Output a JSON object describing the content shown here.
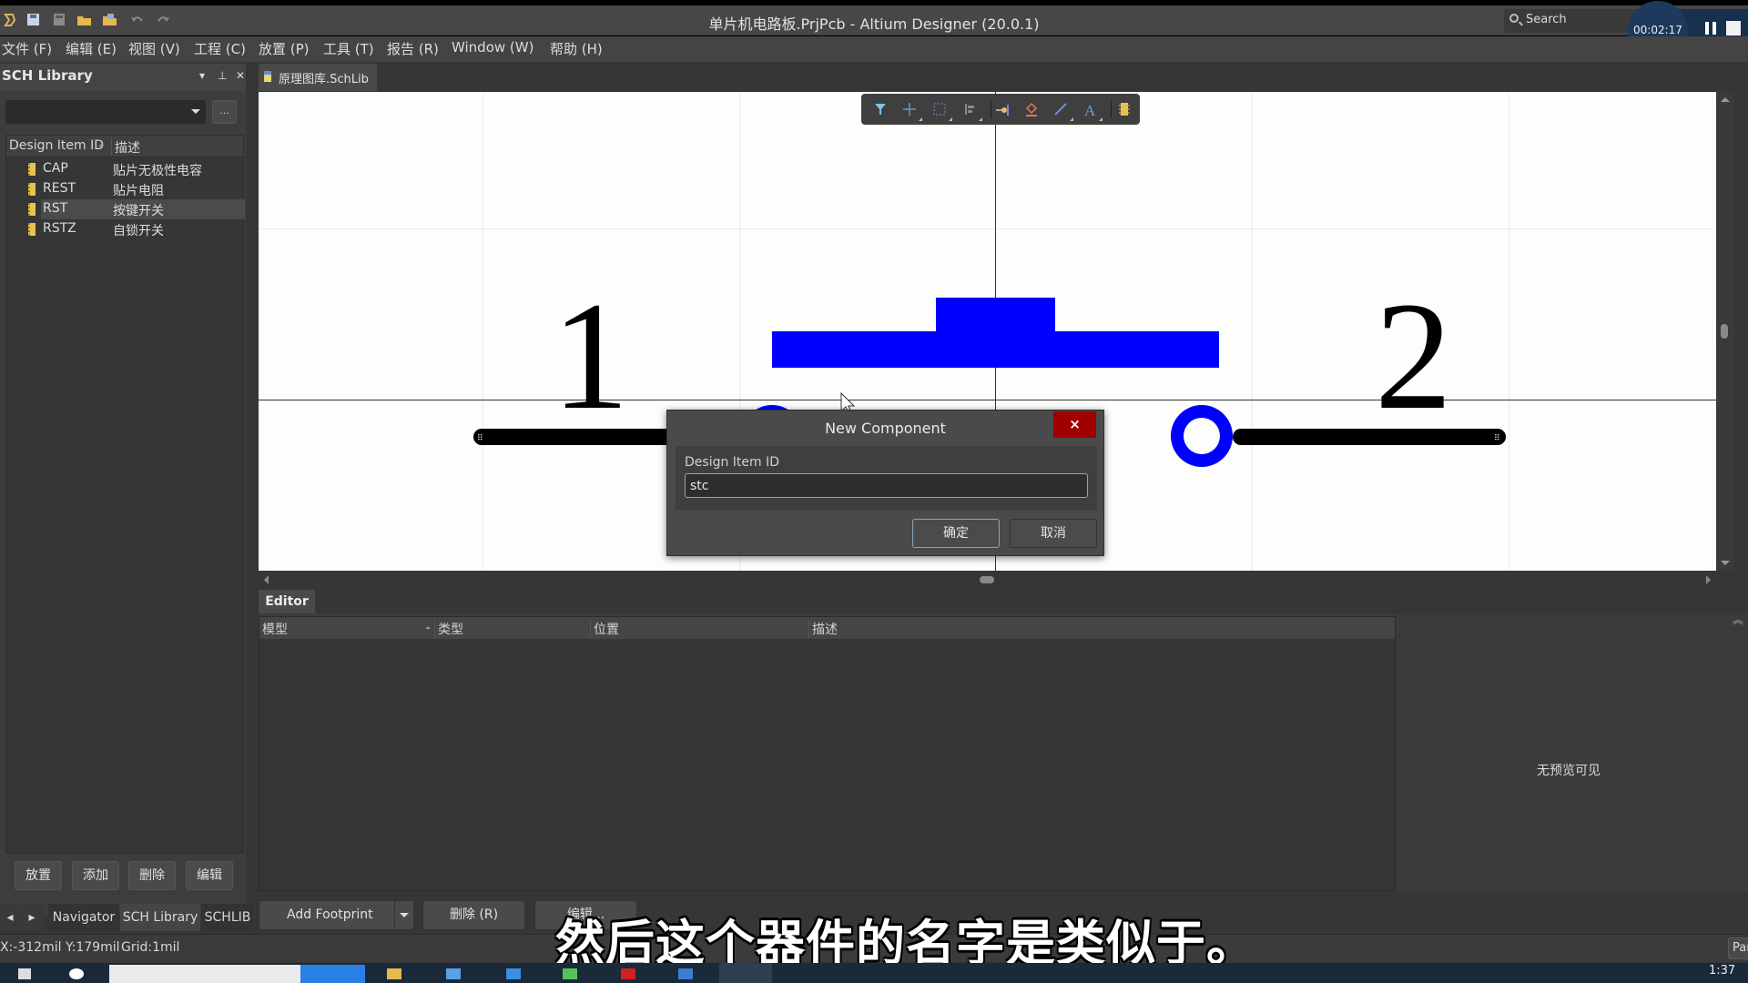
{
  "window": {
    "title": "单片机电路板.PrjPcb - Altium Designer (20.0.1)",
    "search_placeholder": "Search"
  },
  "recording": {
    "elapsed": "00:02:17"
  },
  "menu": [
    {
      "label": "文件 (F)"
    },
    {
      "label": "编辑 (E)"
    },
    {
      "label": "视图 (V)"
    },
    {
      "label": "工程 (C)"
    },
    {
      "label": "放置 (P)"
    },
    {
      "label": "工具 (T)"
    },
    {
      "label": "报告 (R)"
    },
    {
      "label": "Window (W)"
    },
    {
      "label": "帮助 (H)"
    }
  ],
  "sch_library": {
    "title": "SCH Library",
    "filter_value": "",
    "more_label": "...",
    "columns": [
      "Design Item ID",
      "描述"
    ],
    "items": [
      {
        "id": "CAP",
        "desc": "贴片无极性电容",
        "selected": false
      },
      {
        "id": "REST",
        "desc": "贴片电阻",
        "selected": false
      },
      {
        "id": "RST",
        "desc": "按键开关",
        "selected": true
      },
      {
        "id": "RSTZ",
        "desc": "自锁开关",
        "selected": false
      }
    ],
    "buttons": [
      "放置",
      "添加",
      "删除",
      "编辑"
    ]
  },
  "panel_tabs": [
    "Navigator",
    "SCH Library",
    "SCHLIB"
  ],
  "document_tab": "原理图库.SchLib",
  "canvas": {
    "pin_labels": [
      "1",
      "2"
    ],
    "colors": {
      "body": "#0000ff",
      "pin": "#000000",
      "background": "#fdfdfb"
    }
  },
  "active_bar": [
    "filter",
    "move",
    "select",
    "align",
    "pin",
    "shape",
    "line",
    "text",
    "part"
  ],
  "dialog": {
    "title": "New Component",
    "close_label": "×",
    "field_label": "Design Item ID",
    "field_value": "stc",
    "ok_label": "确定",
    "cancel_label": "取消"
  },
  "editor": {
    "tab_label": "Editor",
    "columns": [
      "模型",
      "类型",
      "位置",
      "描述"
    ],
    "rows": [],
    "preview_text": "无预览可见",
    "buttons": {
      "add_footprint": "Add Footprint",
      "delete": "删除 (R)",
      "edit": "编辑..."
    }
  },
  "status": {
    "coords": "X:-312mil Y:179mil",
    "grid": "Grid:1mil",
    "panels_label": "Panels"
  },
  "subtitle": "然后这个器件的名字是类似于。",
  "taskbar": {
    "clock": "1:37"
  }
}
